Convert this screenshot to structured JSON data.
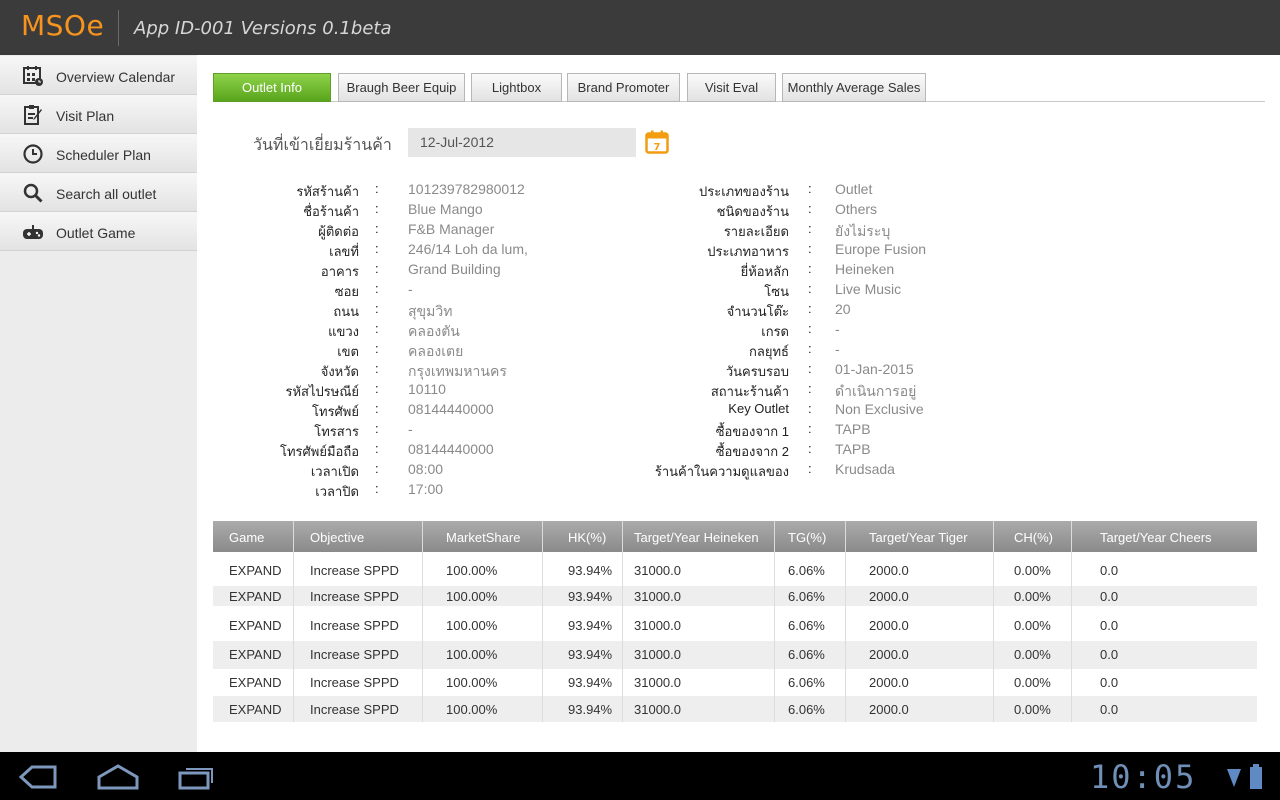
{
  "header": {
    "logo": "MSOe",
    "app_title": "App ID-001 Versions 0.1beta"
  },
  "sidebar": {
    "items": [
      {
        "label": "Overview Calendar",
        "icon": "calendar-grid-icon"
      },
      {
        "label": "Visit Plan",
        "icon": "clipboard-pen-icon"
      },
      {
        "label": "Scheduler Plan",
        "icon": "clock-icon"
      },
      {
        "label": "Search all outlet",
        "icon": "search-icon"
      },
      {
        "label": "Outlet Game",
        "icon": "gamepad-icon"
      }
    ]
  },
  "tabs": [
    {
      "label": "Outlet Info",
      "active": true
    },
    {
      "label": "Braugh Beer Equip",
      "active": false
    },
    {
      "label": "Lightbox",
      "active": false
    },
    {
      "label": "Brand Promoter",
      "active": false
    },
    {
      "label": "Visit Eval",
      "active": false
    },
    {
      "label": "Monthly Average Sales",
      "active": false
    }
  ],
  "visit": {
    "label": "วันที่เข้าเยี่ยมร้านค้า",
    "date": "12-Jul-2012",
    "calendar_icon": "calendar-icon"
  },
  "colon": ":",
  "left_fields": [
    {
      "label": "รหัสร้านค้า",
      "value": "101239782980012"
    },
    {
      "label": "ชื่อร้านค้า",
      "value": "Blue Mango"
    },
    {
      "label": "ผู้ติดต่อ",
      "value": "F&B Manager"
    },
    {
      "label": "เลขที่",
      "value": "246/14 Loh da lum,"
    },
    {
      "label": "อาคาร",
      "value": "Grand Building"
    },
    {
      "label": "ซอย",
      "value": "-"
    },
    {
      "label": "ถนน",
      "value": "สุขุมวิท"
    },
    {
      "label": "แขวง",
      "value": "คลองตัน"
    },
    {
      "label": "เขต",
      "value": "คลองเตย"
    },
    {
      "label": "จังหวัด",
      "value": "กรุงเทพมหานคร"
    },
    {
      "label": "รหัสไปรษณีย์",
      "value": "10110"
    },
    {
      "label": "โทรศัพย์",
      "value": "08144440000"
    },
    {
      "label": "โทรสาร",
      "value": "-"
    },
    {
      "label": "โทรศัพย์มือถือ",
      "value": "08144440000"
    },
    {
      "label": "เวลาเปิด",
      "value": "08:00"
    },
    {
      "label": "เวลาปิด",
      "value": "17:00"
    }
  ],
  "right_fields": [
    {
      "label": "ประเภทของร้าน",
      "value": "Outlet"
    },
    {
      "label": "ชนิดของร้าน",
      "value": "Others"
    },
    {
      "label": "รายละเอียด",
      "value": "ยังไม่ระบุ"
    },
    {
      "label": "ประเภทอาหาร",
      "value": "Europe Fusion"
    },
    {
      "label": "ยี่ห้อหลัก",
      "value": "Heineken"
    },
    {
      "label": "โซน",
      "value": "Live Music"
    },
    {
      "label": "จำนวนโต๊ะ",
      "value": "20"
    },
    {
      "label": "เกรด",
      "value": "-"
    },
    {
      "label": "กลยุทธ์",
      "value": "-"
    },
    {
      "label": "วันครบรอบ",
      "value": "01-Jan-2015"
    },
    {
      "label": "สถานะร้านค้า",
      "value": "ดำเนินการอยู่"
    },
    {
      "label": "Key Outlet",
      "value": "Non Exclusive"
    },
    {
      "label": "ซื้อของจาก 1",
      "value": "TAPB"
    },
    {
      "label": "ซื้อของจาก 2",
      "value": "TAPB"
    },
    {
      "label": "ร้านค้าในความดูแลของ",
      "value": "Krudsada"
    }
  ],
  "table": {
    "columns": [
      "Game",
      "Objective",
      "MarketShare",
      "HK(%)",
      "Target/Year Heineken",
      "TG(%)",
      "Target/Year Tiger",
      "CH(%)",
      "Target/Year Cheers"
    ],
    "rows": [
      [
        "EXPAND",
        "Increase SPPD",
        "100.00%",
        "93.94%",
        "31000.0",
        "6.06%",
        "2000.0",
        "0.00%",
        "0.0"
      ],
      [
        "EXPAND",
        "Increase SPPD",
        "100.00%",
        "93.94%",
        "31000.0",
        "6.06%",
        "2000.0",
        "0.00%",
        "0.0"
      ],
      [
        "EXPAND",
        "Increase SPPD",
        "100.00%",
        "93.94%",
        "31000.0",
        "6.06%",
        "2000.0",
        "0.00%",
        "0.0"
      ],
      [
        "EXPAND",
        "Increase SPPD",
        "100.00%",
        "93.94%",
        "31000.0",
        "6.06%",
        "2000.0",
        "0.00%",
        "0.0"
      ],
      [
        "EXPAND",
        "Increase SPPD",
        "100.00%",
        "93.94%",
        "31000.0",
        "6.06%",
        "2000.0",
        "0.00%",
        "0.0"
      ],
      [
        "EXPAND",
        "Increase SPPD",
        "100.00%",
        "93.94%",
        "31000.0",
        "6.06%",
        "2000.0",
        "0.00%",
        "0.0"
      ]
    ]
  },
  "system_bar": {
    "clock": "10:05",
    "back_icon": "back-icon",
    "home_icon": "home-icon",
    "recents_icon": "recent-apps-icon",
    "wifi_icon": "wifi-icon",
    "battery_icon": "battery-icon"
  },
  "colors": {
    "accent": "#f7941d",
    "active_tab": "#6cbf2e",
    "header_bg": "#3b3b3b",
    "clock": "#6f8fb6"
  }
}
